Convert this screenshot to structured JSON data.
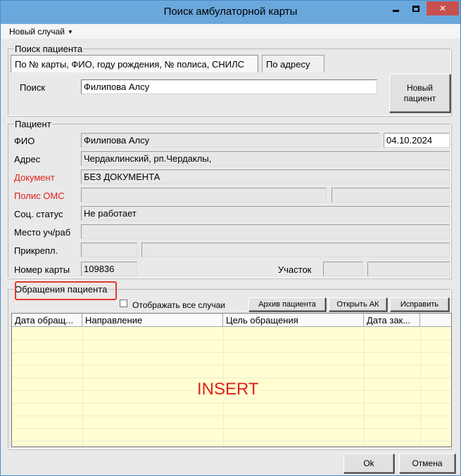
{
  "window": {
    "title": "Поиск амбулаторной карты",
    "controls": {
      "minimize": "minimize-icon",
      "maximize": "maximize-icon",
      "close": "✕"
    }
  },
  "menu": {
    "new_case": "Новый случай"
  },
  "search": {
    "legend": "Поиск пациента",
    "tabs": [
      "По № карты, ФИО, году рождения, № полиса, СНИЛС",
      "По адресу"
    ],
    "label": "Поиск",
    "value": "Филипова Алсу",
    "new_patient_line1": "Новый",
    "new_patient_line2": "пациент"
  },
  "patient": {
    "legend": "Пациент",
    "fio_label": "ФИО",
    "fio_value": "Филипова Алсу",
    "birth_date": "04.10.2024",
    "address_label": "Адрес",
    "address_value": "Чердаклинский, рп.Чердаклы,",
    "document_label": "Документ",
    "document_value": "БЕЗ ДОКУМЕНТА",
    "policy_label": "Полис ОМС",
    "policy_value": "",
    "policy_value2": "",
    "social_label": "Соц. статус",
    "social_value": "Не работает",
    "work_label": "Место уч/раб",
    "work_value": "",
    "attach_label": "Прикрепл.",
    "attach_value1": "",
    "attach_value2": "",
    "card_label": "Номер карты",
    "card_value": "109836",
    "district_label": "Участок",
    "district_value1": "",
    "district_value2": ""
  },
  "appeals": {
    "legend": "Обращения пациента",
    "show_all_label": "Отображать все случаи",
    "show_all_checked": false,
    "buttons": [
      "Архив пациента",
      "Открыть АК",
      "Исправить"
    ],
    "columns": [
      "Дата обращ...",
      "Направление",
      "Цель обращения",
      "Дата зак..."
    ],
    "overlay_text": "INSERT"
  },
  "footer": {
    "ok": "Ok",
    "cancel": "Отмена"
  },
  "colors": {
    "titlebar": "#6aa7dc",
    "close_button": "#c75050",
    "grid_background": "#ffffd2",
    "required_label": "#e0201c",
    "highlight": "#e23a2e"
  }
}
